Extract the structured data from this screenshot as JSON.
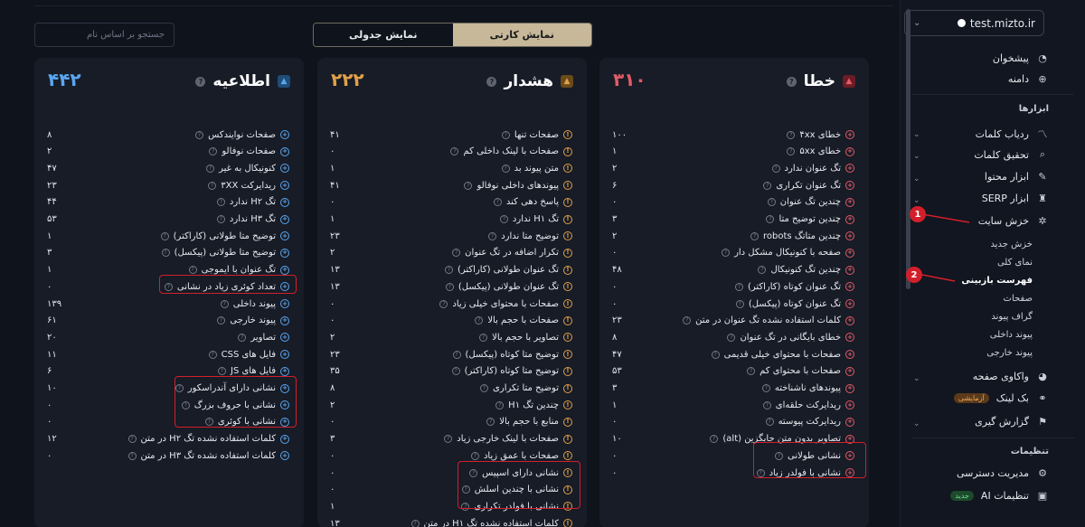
{
  "sidebar": {
    "site": "test.mizto.ir",
    "items_top": [
      {
        "label": "پیشخوان",
        "icon": "pie-chart-icon"
      },
      {
        "label": "دامنه",
        "icon": "globe-icon"
      }
    ],
    "tools_title": "ابزارها",
    "tools": [
      {
        "label": "ردیاب کلمات",
        "icon": "chart-line-icon"
      },
      {
        "label": "تحقیق کلمات",
        "icon": "search-icon"
      },
      {
        "label": "ابزار محتوا",
        "icon": "pen-icon"
      },
      {
        "label": "ابزار SERP",
        "icon": "trophy-icon"
      },
      {
        "label": "خزش سایت",
        "icon": "bug-icon"
      }
    ],
    "crawl_sub": [
      "خزش جدید",
      "نمای کلی",
      "فهرست بازبینی",
      "صفحات",
      "گراف پیوند",
      "پیوند داخلی",
      "پیوند خارجی"
    ],
    "more": [
      {
        "label": "واکاوی صفحه",
        "icon": "dashboard-icon"
      },
      {
        "label": "بک لینک",
        "icon": "link-icon",
        "badge": "آزمایشی"
      },
      {
        "label": "گزارش گیری",
        "icon": "flag-icon"
      }
    ],
    "settings_title": "تنظیمات",
    "settings": [
      {
        "label": "مدیریت دسترسی",
        "icon": "user-gear-icon"
      },
      {
        "label": "تنظیمات AI",
        "icon": "ai-icon",
        "badge": "جدید"
      }
    ]
  },
  "markers": [
    "1",
    "2"
  ],
  "search_placeholder": "جستجو بر اساس نام",
  "view_toggle": {
    "card": "نمایش کارتی",
    "table": "نمایش جدولی"
  },
  "colors": {
    "error": "#e25b66",
    "warning": "#e0a04a",
    "info": "#5aa6f0"
  },
  "cards": {
    "error": {
      "title": "خطا",
      "count": "۳۱۰",
      "rows": [
        {
          "label": "خطای ۴xx",
          "value": "۱۰۰"
        },
        {
          "label": "خطای ۵xx",
          "value": "۱"
        },
        {
          "label": "تگ عنوان ندارد",
          "value": "۲"
        },
        {
          "label": "تگ عنوان تکراری",
          "value": "۶"
        },
        {
          "label": "چندین تگ عنوان",
          "value": "۰"
        },
        {
          "label": "چندین توضیح متا",
          "value": "۳"
        },
        {
          "label": "چندین متاتگ robots",
          "value": "۲"
        },
        {
          "label": "صفحه با کنونیکال مشکل دار",
          "value": "۰"
        },
        {
          "label": "چندین تگ کنونیکال",
          "value": "۴۸"
        },
        {
          "label": "تگ عنوان کوتاه (کاراکتر)",
          "value": "۰"
        },
        {
          "label": "تگ عنوان کوتاه (پیکسل)",
          "value": "۰"
        },
        {
          "label": "کلمات استفاده نشده تگ عنوان در متن",
          "value": "۲۳"
        },
        {
          "label": "خطای بایگانی در تگ عنوان",
          "value": "۸"
        },
        {
          "label": "صفحات با محتوای خیلی قدیمی",
          "value": "۴۷"
        },
        {
          "label": "صفحات با محتوای کم",
          "value": "۵۳"
        },
        {
          "label": "پیوندهای ناشناخته",
          "value": "۳"
        },
        {
          "label": "ریدایرکت حلقه‌ای",
          "value": "۱"
        },
        {
          "label": "ریدایرکت پیوسته",
          "value": "۰"
        },
        {
          "label": "تصاویر بدون متن جایگزین (alt)",
          "value": "۱۰"
        },
        {
          "label": "نشانی طولانی",
          "value": "۰"
        },
        {
          "label": "نشانی با فولدر زیاد",
          "value": "۰"
        }
      ]
    },
    "warning": {
      "title": "هشدار",
      "count": "۲۲۲",
      "rows": [
        {
          "label": "صفحات تنها",
          "value": "۴۱"
        },
        {
          "label": "صفحات با لینک داخلی کم",
          "value": "۰"
        },
        {
          "label": "متن پیوند بد",
          "value": "۱"
        },
        {
          "label": "پیوندهای داخلی نوفالو",
          "value": "۴۱"
        },
        {
          "label": "پاسخ دهی کند",
          "value": "۰"
        },
        {
          "label": "تگ H۱ ندارد",
          "value": "۱"
        },
        {
          "label": "توضیح متا ندارد",
          "value": "۲۳"
        },
        {
          "label": "تکرار اضافه در تگ عنوان",
          "value": "۲"
        },
        {
          "label": "تگ عنوان طولانی (کاراکتر)",
          "value": "۱۳"
        },
        {
          "label": "تگ عنوان طولانی (پیکسل)",
          "value": "۱۳"
        },
        {
          "label": "صفحات با محتوای خیلی زیاد",
          "value": "۰"
        },
        {
          "label": "صفحات با حجم بالا",
          "value": "۰"
        },
        {
          "label": "تصاویر با حجم بالا",
          "value": "۲"
        },
        {
          "label": "توضیح متا کوتاه (پیکسل)",
          "value": "۲۳"
        },
        {
          "label": "توضیح متا کوتاه (کاراکتر)",
          "value": "۳۵"
        },
        {
          "label": "توضیح متا تکراری",
          "value": "۸"
        },
        {
          "label": "چندین تگ H۱",
          "value": "۲"
        },
        {
          "label": "منابع با حجم بالا",
          "value": "۰"
        },
        {
          "label": "صفحات با لینک خارجی زیاد",
          "value": "۳"
        },
        {
          "label": "صفحات با عمق زیاد",
          "value": "۰"
        },
        {
          "label": "نشانی دارای اسپیس",
          "value": "۰"
        },
        {
          "label": "نشانی با چندین اسلش",
          "value": "۰"
        },
        {
          "label": "نشانی با فولدر تکراری",
          "value": "۱"
        },
        {
          "label": "کلمات استفاده نشده تگ H۱ در متن",
          "value": "۱۳"
        }
      ]
    },
    "info": {
      "title": "اطلاعیه",
      "count": "۴۴۲",
      "rows": [
        {
          "label": "صفحات نوایندکس",
          "value": "۸"
        },
        {
          "label": "صفحات نوفالو",
          "value": "۲"
        },
        {
          "label": "کنونیکال به غیر",
          "value": "۴۷"
        },
        {
          "label": "ریدایرکت ۳XX",
          "value": "۲۳"
        },
        {
          "label": "تگ H۲ ندارد",
          "value": "۴۴"
        },
        {
          "label": "تگ H۳ ندارد",
          "value": "۵۳"
        },
        {
          "label": "توضیح متا طولانی (کاراکتر)",
          "value": "۱"
        },
        {
          "label": "توضیح متا طولانی (پیکسل)",
          "value": "۳"
        },
        {
          "label": "تگ عنوان با ایموجی",
          "value": "۱"
        },
        {
          "label": "تعداد کوئری زیاد در نشانی",
          "value": "۰"
        },
        {
          "label": "پیوند داخلی",
          "value": "۱۳۹"
        },
        {
          "label": "پیوند خارجی",
          "value": "۶۱"
        },
        {
          "label": "تصاویر",
          "value": "۲۰"
        },
        {
          "label": "فایل های CSS",
          "value": "۱۱"
        },
        {
          "label": "فایل های JS",
          "value": "۶"
        },
        {
          "label": "نشانی دارای آندراسکور",
          "value": "۱۰"
        },
        {
          "label": "نشانی با حروف بزرگ",
          "value": "۰"
        },
        {
          "label": "نشانی با کوئری",
          "value": "۰"
        },
        {
          "label": "کلمات استفاده نشده تگ H۲ در متن",
          "value": "۱۲"
        },
        {
          "label": "کلمات استفاده نشده تگ H۳ در متن",
          "value": "۰"
        }
      ]
    }
  }
}
